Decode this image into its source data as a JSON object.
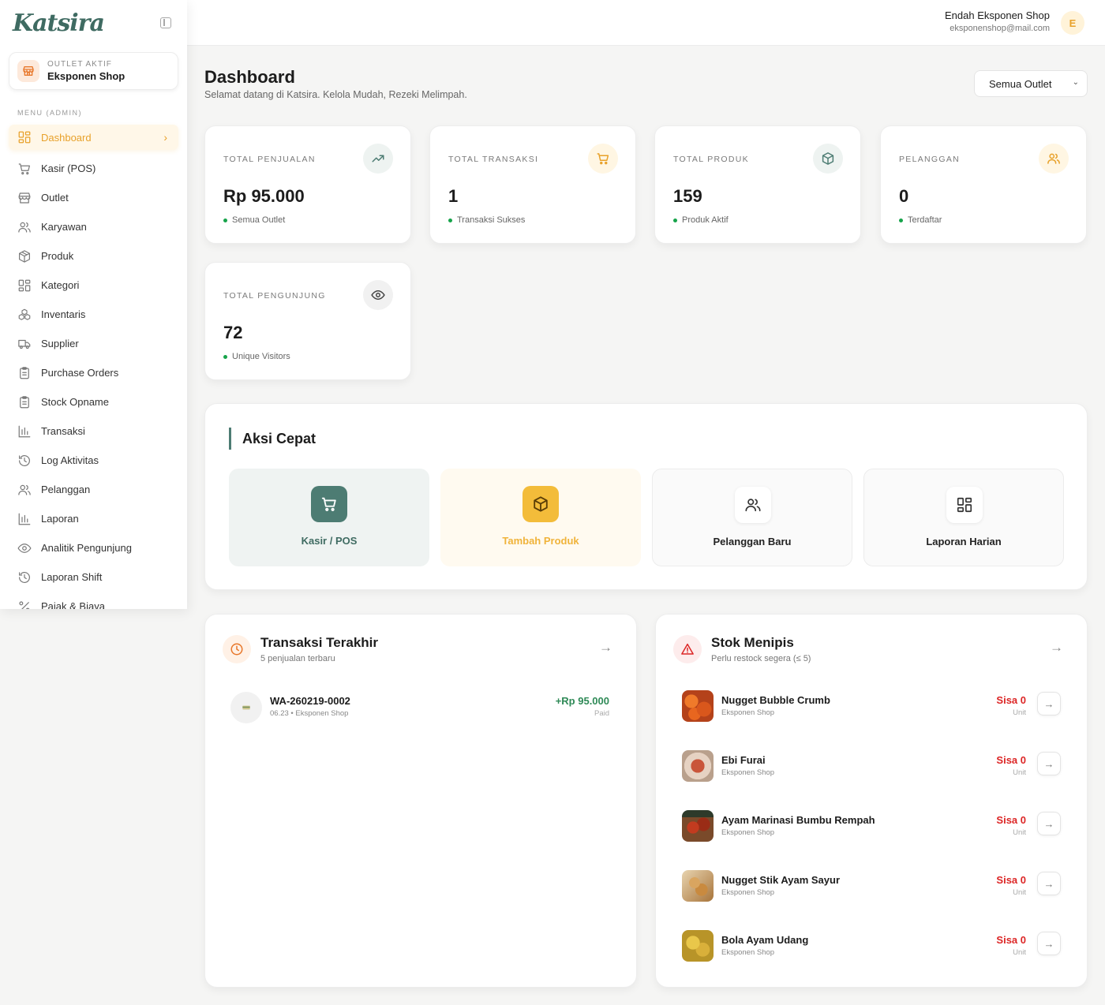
{
  "brand": {
    "logo": "Katsira"
  },
  "outlet_card": {
    "label": "OUTLET AKTIF",
    "name": "Eksponen Shop"
  },
  "menu": {
    "title": "MENU (ADMIN)",
    "items": [
      {
        "label": "Dashboard",
        "icon": "grid-icon"
      },
      {
        "label": "Kasir (POS)",
        "icon": "cart-icon"
      },
      {
        "label": "Outlet",
        "icon": "store-icon"
      },
      {
        "label": "Karyawan",
        "icon": "users-icon"
      },
      {
        "label": "Produk",
        "icon": "box-icon"
      },
      {
        "label": "Kategori",
        "icon": "grid-icon"
      },
      {
        "label": "Inventaris",
        "icon": "boxes-icon"
      },
      {
        "label": "Supplier",
        "icon": "truck-icon"
      },
      {
        "label": "Purchase Orders",
        "icon": "clipboard-icon"
      },
      {
        "label": "Stock Opname",
        "icon": "clipboard-icon"
      },
      {
        "label": "Transaksi",
        "icon": "bar-chart-icon"
      },
      {
        "label": "Log Aktivitas",
        "icon": "history-icon"
      },
      {
        "label": "Pelanggan",
        "icon": "users-icon"
      },
      {
        "label": "Laporan",
        "icon": "bar-chart-icon"
      },
      {
        "label": "Analitik Pengunjung",
        "icon": "eye-icon"
      },
      {
        "label": "Laporan Shift",
        "icon": "history-icon"
      },
      {
        "label": "Pajak & Biaya",
        "icon": "percent-icon"
      }
    ]
  },
  "header": {
    "user_name": "Endah Eksponen Shop",
    "user_email": "eksponenshop@mail.com",
    "avatar_initial": "E"
  },
  "page": {
    "title": "Dashboard",
    "subtitle": "Selamat datang di Katsira. Kelola Mudah, Rezeki Melimpah.",
    "outlet_filter": "Semua Outlet"
  },
  "stats": [
    {
      "label": "TOTAL PENJUALAN",
      "value": "Rp 95.000",
      "note": "Semua Outlet",
      "icon": "trending-up-icon"
    },
    {
      "label": "TOTAL TRANSAKSI",
      "value": "1",
      "note": "Transaksi Sukses",
      "icon": "cart-icon"
    },
    {
      "label": "TOTAL PRODUK",
      "value": "159",
      "note": "Produk Aktif",
      "icon": "box-icon"
    },
    {
      "label": "PELANGGAN",
      "value": "0",
      "note": "Terdaftar",
      "icon": "users-icon"
    },
    {
      "label": "TOTAL PENGUNJUNG",
      "value": "72",
      "note": "Unique Visitors",
      "icon": "eye-icon"
    }
  ],
  "quick_actions": {
    "title": "Aksi Cepat",
    "items": [
      {
        "label": "Kasir / POS",
        "icon": "cart-icon"
      },
      {
        "label": "Tambah Produk",
        "icon": "box-icon"
      },
      {
        "label": "Pelanggan Baru",
        "icon": "users-icon"
      },
      {
        "label": "Laporan Harian",
        "icon": "grid-icon"
      }
    ]
  },
  "recent_transactions": {
    "title": "Transaksi Terakhir",
    "subtitle": "5 penjualan terbaru",
    "items": [
      {
        "id": "WA-260219-0002",
        "time": "06.23",
        "shop": "Eksponen Shop",
        "amount": "+Rp 95.000",
        "status": "Paid"
      }
    ]
  },
  "low_stock": {
    "title": "Stok Menipis",
    "subtitle": "Perlu restock segera (≤ 5)",
    "items": [
      {
        "name": "Nugget Bubble Crumb",
        "shop": "Eksponen Shop",
        "sisa": "Sisa 0",
        "unit": "Unit"
      },
      {
        "name": "Ebi Furai",
        "shop": "Eksponen Shop",
        "sisa": "Sisa 0",
        "unit": "Unit"
      },
      {
        "name": "Ayam Marinasi Bumbu Rempah",
        "shop": "Eksponen Shop",
        "sisa": "Sisa 0",
        "unit": "Unit"
      },
      {
        "name": "Nugget Stik Ayam Sayur",
        "shop": "Eksponen Shop",
        "sisa": "Sisa 0",
        "unit": "Unit"
      },
      {
        "name": "Bola Ayam Udang",
        "shop": "Eksponen Shop",
        "sisa": "Sisa 0",
        "unit": "Unit"
      }
    ]
  },
  "colors": {
    "accent": "#e8a12a",
    "primary": "#4d7c73",
    "success": "#2f8a57",
    "danger": "#dc2626"
  }
}
